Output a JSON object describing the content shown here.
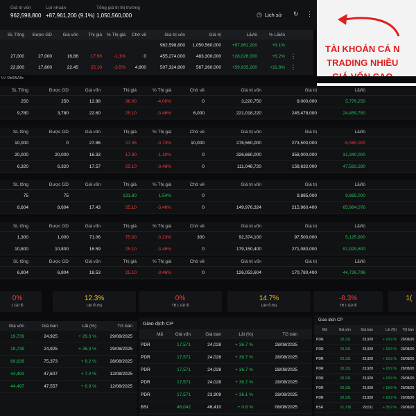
{
  "summary": {
    "label1": "Giá trị vốn",
    "value1": "962,598,800",
    "label2": "Lợi nhuận",
    "value2": "+87,961,200 (9.1%)",
    "label3": "Tổng giá trị thị trường",
    "value3": "1,050,560,000",
    "history": "Lịch sử"
  },
  "annotation": "TÀI KHOẢN CÁ N\nTRADING NHIỀU\nGIÁ VỐN CAO",
  "acct_header": [
    "SL Tổng",
    "Được GD",
    "Giá vốn",
    "Thị giá",
    "% Thị giá",
    "Chờ về",
    "Giá trị vốn",
    "Giá trị",
    "Lãi/lỗ",
    "% Lãi/lỗ"
  ],
  "acct_total": [
    "",
    "",
    "",
    "",
    "",
    "",
    "962,598,800",
    "1,050,560,000",
    "+87,961,200",
    "+9.1%"
  ],
  "acct_rows": [
    [
      "27,000",
      "27,000",
      "16.86",
      "17.90",
      "-1.1%",
      "0",
      "455,274,000",
      "483,300,000",
      "+28,026,000",
      "+6.2%"
    ],
    [
      "22,600",
      "17,800",
      "22.45",
      "25.10",
      "-3.5%",
      "4,800",
      "507,324,800",
      "567,260,000",
      "+59,935,200",
      "+11.8%"
    ]
  ],
  "date_range": "07 05/09/25",
  "tables": [
    {
      "header": [
        "SL Tổng",
        "Được GD",
        "Giá vốn",
        "Thị giá",
        "% Thị giá",
        "Chờ về",
        "Giá trị vốn",
        "Giá trị",
        "Lãi/lỗ"
      ],
      "rows": [
        [
          "250",
          "250",
          "12.88",
          "36.00",
          "-4.00%",
          "0",
          "3,220,750",
          "9,000,000",
          "5,779,250"
        ],
        [
          "9,780",
          "3,780",
          "22.60",
          "25.10",
          "-3.46%",
          "6,000",
          "221,018,220",
          "245,478,000",
          "24,459,780"
        ]
      ]
    },
    {
      "header": [
        "SL tổng",
        "Được GD",
        "Giá vốn",
        "Thị giá",
        "% Thị giá",
        "Chờ về",
        "Giá trị vốn",
        "Giá trị",
        "Lãi/lỗ"
      ],
      "rows": [
        [
          "10,000",
          "0",
          "27.86",
          "27.35",
          "-0.73%",
          "10,000",
          "278,560,000",
          "273,500,000",
          "-5,060,000"
        ],
        [
          "20,000",
          "20,000",
          "16.33",
          "17.90",
          "-1.10%",
          "0",
          "326,660,000",
          "358,000,000",
          "31,340,000"
        ],
        [
          "6,320",
          "6,320",
          "17.57",
          "25.10",
          "-3.46%",
          "0",
          "111,048,720",
          "158,632,000",
          "47,583,280"
        ]
      ]
    },
    {
      "header": [
        "SL tổng",
        "Được GD",
        "Giá vốn",
        "Thị giá",
        "% Thị giá",
        "Chờ về",
        "Giá trị vốn",
        "Giá trị",
        "Lãi/lỗ"
      ],
      "rows": [
        [
          "75",
          "75",
          "",
          "131.80",
          "1.54%",
          "0",
          "",
          "9,885,000",
          "9,885,000"
        ],
        [
          "8,604",
          "8,604",
          "17.43",
          "25.10",
          "-3.46%",
          "0",
          "149,976,324",
          "215,960,400",
          "65,984,076"
        ]
      ]
    },
    {
      "header": [
        "SL tổng",
        "Được GD",
        "Giá vốn",
        "Thị giá",
        "% Thị giá",
        "Chờ về",
        "Giá trị vốn",
        "Giá trị",
        "Lãi/lỗ"
      ],
      "rows": [
        [
          "1,300",
          "1,000",
          "71.06",
          "75.00",
          "-3.23%",
          "300",
          "92,374,100",
          "97,500,000",
          "5,125,900"
        ],
        [
          "10,800",
          "10,800",
          "16.59",
          "25.10",
          "-3.46%",
          "0",
          "179,150,400",
          "271,080,000",
          "91,929,600"
        ]
      ]
    },
    {
      "header": [
        "SL tổng",
        "Được GD",
        "Giá vốn",
        "Thị giá",
        "% Thị giá",
        "Chờ về",
        "Giá trị vốn",
        "Giá trị",
        "Lãi/lỗ"
      ],
      "rows": [
        [
          "6,804",
          "6,804",
          "18.53",
          "25.10",
          "-3.46%",
          "0",
          "126,053,604",
          "170,780,400",
          "44,726,796"
        ]
      ]
    }
  ],
  "cards": [
    {
      "value": "0%",
      "label": "1 GD lỗ"
    },
    {
      "value": "12.3%",
      "label": "Lãi/ lỗ (%)"
    },
    {
      "value": "0%",
      "label": "TB 1 GD lỗ"
    },
    {
      "value": "14.7%",
      "label": "Lãi/ lỗ (%)"
    },
    {
      "value": "-8.3%",
      "label": "TB 1 GD lỗ"
    },
    {
      "value": "1(",
      "label": ""
    }
  ],
  "left_trades": {
    "header": [
      "Giá vốn",
      "Giá bán",
      "Lãi (%)",
      "TG bán"
    ],
    "rows": [
      [
        "19,739",
        "24,925",
        "+ 26.3 %",
        "29/08/2025"
      ],
      [
        "19,739",
        "24,925",
        "+ 26.3 %",
        "29/08/2025"
      ],
      [
        "69,639",
        "75,373",
        "+ 8.2 %",
        "28/08/2025"
      ],
      [
        "44,493",
        "47,607",
        "+ 7.0 %",
        "12/08/2025"
      ],
      [
        "44,497",
        "47,557",
        "+ 6.9 %",
        "12/08/2025"
      ]
    ]
  },
  "mid_trades": {
    "title": "Giao dịch CP",
    "header": [
      "Mã",
      "Giá vốn",
      "Giá bán",
      "Lãi (%)",
      "TG bán"
    ],
    "rows": [
      [
        "PDR",
        "17,571",
        "24,028",
        "+ 36.7 %",
        "28/08/2025"
      ],
      [
        "PDR",
        "17,571",
        "24,028",
        "+ 36.7 %",
        "28/08/2025"
      ],
      [
        "PDR",
        "17,571",
        "24,028",
        "+ 36.7 %",
        "28/08/2025"
      ],
      [
        "PDR",
        "17,571",
        "24,028",
        "+ 36.7 %",
        "28/08/2025"
      ],
      [
        "PDR",
        "17,571",
        "23,909",
        "+ 36.1 %",
        "28/08/2025"
      ],
      [
        "BSI",
        "46,042",
        "46,410",
        "+ 0.8 %",
        "06/08/2025"
      ]
    ]
  },
  "right_trades": {
    "title": "Giao dịch CP",
    "header": [
      "Mã",
      "Giá vốn",
      "Giá bán",
      "Lãi (%)",
      "TG bán"
    ],
    "rows": [
      [
        "PDR",
        "20,131",
        "23,928",
        "+ 18.9 %",
        "29/08/20"
      ],
      [
        "PDR",
        "20,131",
        "23,928",
        "+ 18.9 %",
        "29/08/20"
      ],
      [
        "PDR",
        "20,131",
        "23,928",
        "+ 18.9 %",
        "29/08/20"
      ],
      [
        "PDR",
        "20,131",
        "23,928",
        "+ 18.9 %",
        "29/08/20"
      ],
      [
        "PDR",
        "20,131",
        "23,928",
        "+ 18.9 %",
        "29/08/20"
      ],
      [
        "PDR",
        "20,131",
        "23,928",
        "+ 18.9 %",
        "29/08/20"
      ],
      [
        "PDR",
        "20,131",
        "23,928",
        "+ 18.9 %",
        "29/08/20"
      ],
      [
        "BSR",
        "21,708",
        "29,511",
        "+ 35.9 %",
        "29/08/20"
      ]
    ]
  },
  "colors": {
    "positive": "#25c15a",
    "negative": "#ff3b3b",
    "annotation": "#e01f1f"
  }
}
